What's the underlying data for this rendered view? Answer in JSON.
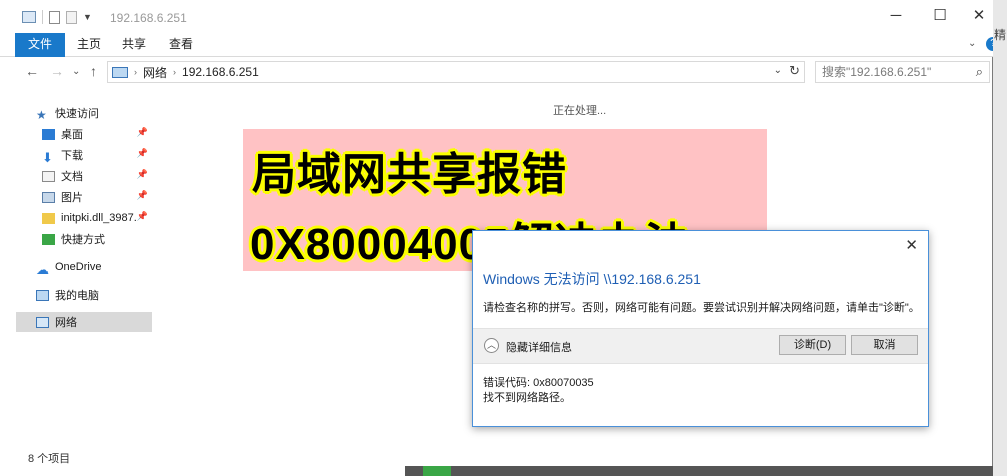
{
  "titlebar": {
    "title": "192.168.6.251",
    "minimize": "─",
    "maximize": "☐",
    "close": "✕"
  },
  "ribbon": {
    "tabs": [
      "文件",
      "主页",
      "共享",
      "查看"
    ],
    "help": "?"
  },
  "address": {
    "crumbs": [
      "网络",
      "192.168.6.251"
    ],
    "search_placeholder": "搜索\"192.168.6.251\""
  },
  "navpane": {
    "items": [
      {
        "label": "快速访问",
        "icon": "star-icon",
        "color": "#3a76b8",
        "pinned": false
      },
      {
        "label": "桌面",
        "icon": "desktop-icon",
        "color": "#2a7bd4",
        "pinned": true
      },
      {
        "label": "下载",
        "icon": "download-icon",
        "color": "#2a7bd4",
        "pinned": true
      },
      {
        "label": "文档",
        "icon": "documents-icon",
        "color": "#8a8a8a",
        "pinned": true
      },
      {
        "label": "图片",
        "icon": "pictures-icon",
        "color": "#5a7ea8",
        "pinned": true
      },
      {
        "label": "initpki.dll_3987.",
        "icon": "folder-icon",
        "color": "#f0c94a",
        "pinned": true
      },
      {
        "label": "快捷方式",
        "icon": "shortcut-icon",
        "color": "#3aa646",
        "pinned": false
      },
      {
        "label": "OneDrive",
        "icon": "cloud-icon",
        "color": "#2a7bd4",
        "pinned": false
      },
      {
        "label": "我的电脑",
        "icon": "computer-icon",
        "color": "#3a76b8",
        "pinned": false
      },
      {
        "label": "网络",
        "icon": "network-icon",
        "color": "#3a76b8",
        "pinned": false
      }
    ]
  },
  "content": {
    "processing": "正在处理..."
  },
  "overlay": {
    "line1": "局域网共享报错",
    "line2": "0X80004005解决办法"
  },
  "dialog": {
    "heading": "Windows 无法访问 \\\\192.168.6.251",
    "message": "请检查名称的拼写。否则，网络可能有问题。要尝试识别并解决网络问题，请单击\"诊断\"。",
    "toggle_label": "隐藏详细信息",
    "diagnose_label": "诊断(D)",
    "cancel_label": "取消",
    "error_code": "错误代码: 0x80070035",
    "error_detail": "找不到网络路径。"
  },
  "statusbar": {
    "count": "8 个项目"
  },
  "rightstrip": {
    "glyph": "精"
  }
}
